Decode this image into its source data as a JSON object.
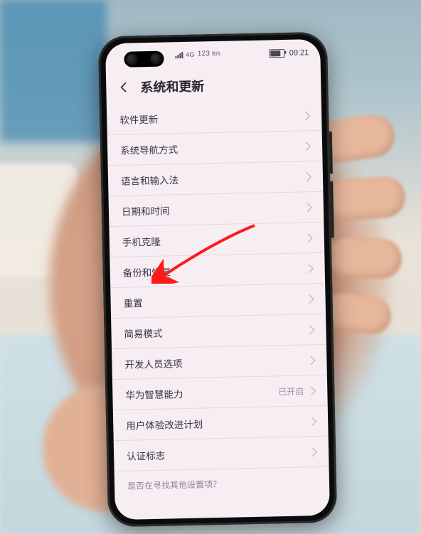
{
  "status_bar": {
    "network_label": "123",
    "network_sub": "B/s",
    "time": "09:21"
  },
  "header": {
    "title": "系统和更新"
  },
  "settings": {
    "items": [
      {
        "label": "软件更新",
        "value": ""
      },
      {
        "label": "系统导航方式",
        "value": ""
      },
      {
        "label": "语言和输入法",
        "value": ""
      },
      {
        "label": "日期和时间",
        "value": ""
      },
      {
        "label": "手机克隆",
        "value": ""
      },
      {
        "label": "备份和恢复",
        "value": ""
      },
      {
        "label": "重置",
        "value": ""
      },
      {
        "label": "简易模式",
        "value": ""
      },
      {
        "label": "开发人员选项",
        "value": ""
      },
      {
        "label": "华为智慧能力",
        "value": "已开启"
      },
      {
        "label": "用户体验改进计划",
        "value": ""
      },
      {
        "label": "认证标志",
        "value": ""
      }
    ]
  },
  "footer": {
    "search_hint": "是否在寻找其他设置项？"
  },
  "annotation": {
    "target_item_index": 6,
    "color": "#ff1a1a"
  }
}
